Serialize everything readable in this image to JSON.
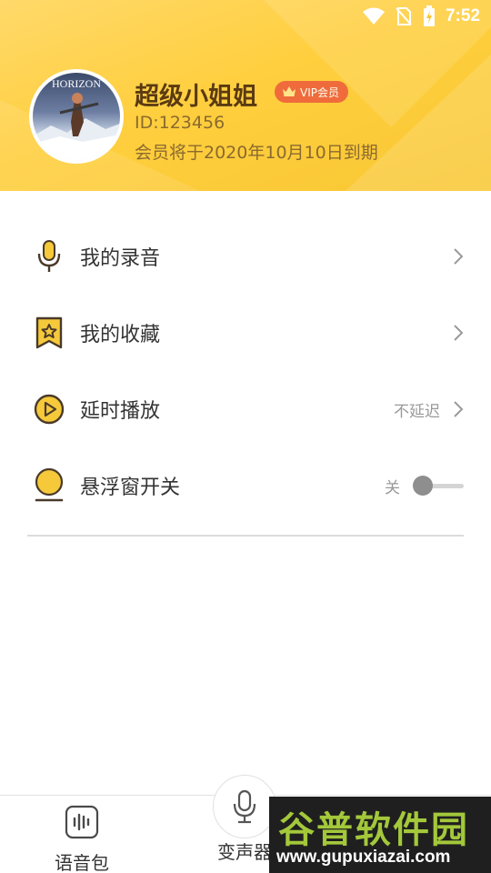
{
  "status_bar": {
    "time": "7:52"
  },
  "profile": {
    "name": "超级小姐姐",
    "vip_badge": "VIP会员",
    "id_text": "ID:123456",
    "expiry_text": "会员将于2020年10月10日到期",
    "avatar_text": "HORIZON"
  },
  "menu": {
    "items": [
      {
        "label": "我的录音",
        "icon": "microphone-icon"
      },
      {
        "label": "我的收藏",
        "icon": "bookmark-star-icon"
      },
      {
        "label": "延时播放",
        "icon": "play-circle-icon",
        "value": "不延迟"
      },
      {
        "label": "悬浮窗开关",
        "icon": "floating-ball-icon",
        "value": "关",
        "toggle_on": false
      }
    ]
  },
  "bottom_nav": {
    "items": [
      {
        "label": "语音包",
        "icon": "voice-pack-icon"
      },
      {
        "label": "变声器",
        "icon": "microphone-icon"
      }
    ]
  },
  "watermark": {
    "title": "谷普软件园",
    "url": "www.gupuxiazai.com"
  },
  "colors": {
    "accent": "#f9c733",
    "icon": "#5a3a12",
    "vip": "#f06b3c"
  }
}
